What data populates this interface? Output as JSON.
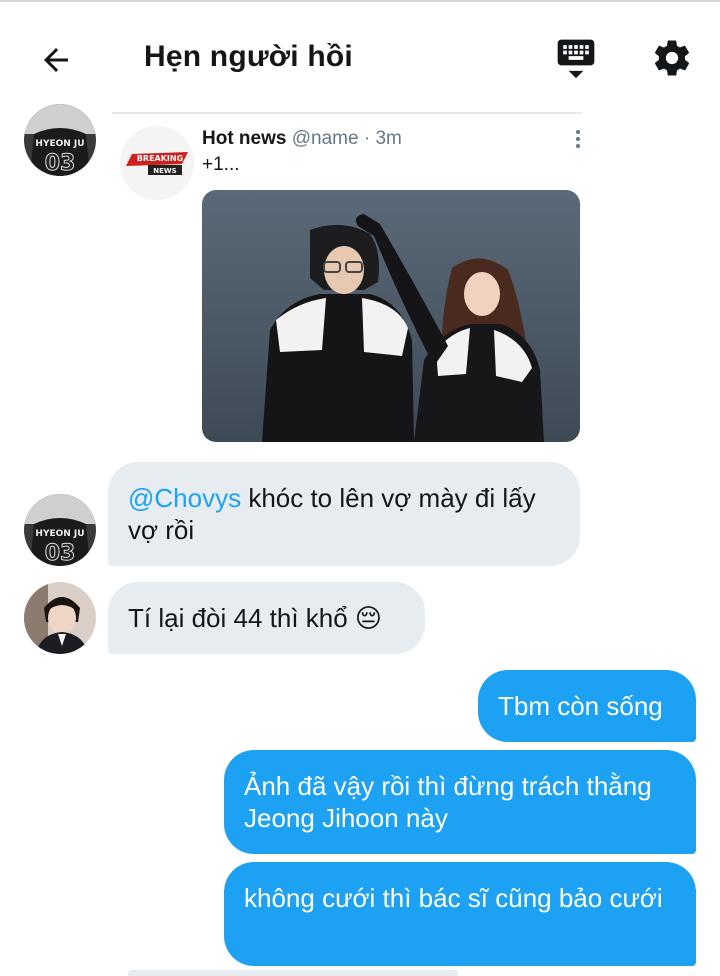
{
  "header": {
    "title": "Hẹn người hồi"
  },
  "tweet": {
    "name": "Hot news",
    "handle": "@name",
    "time": "· 3m",
    "text": "+1...",
    "logo_line1": "BREAKING",
    "logo_line2": "NEWS"
  },
  "messages": {
    "m1_mention": "@Chovys",
    "m1_text": " khóc to lên vợ mày đi lấy vợ rồi",
    "m2_text": "Tí lại đòi 44 thì khổ 😔",
    "m3_text": "Tbm còn sống",
    "m4_text": "Ảnh đã vậy rồi thì đừng trách thằng Jeong Jihoon này",
    "m5_text": "không cưới thì bác sĩ cũng bảo cưới"
  },
  "avatar_jersey": {
    "line1": "HYEON JU",
    "line2": "03"
  },
  "colors": {
    "accent": "#1da1f2",
    "incoming_bubble": "#e6ecf0",
    "text_primary": "#14171a",
    "text_secondary": "#657786"
  },
  "icons": {
    "back": "arrow-left-icon",
    "keyboard": "keyboard-icon",
    "settings": "gear-icon",
    "more": "more-vertical-icon"
  }
}
